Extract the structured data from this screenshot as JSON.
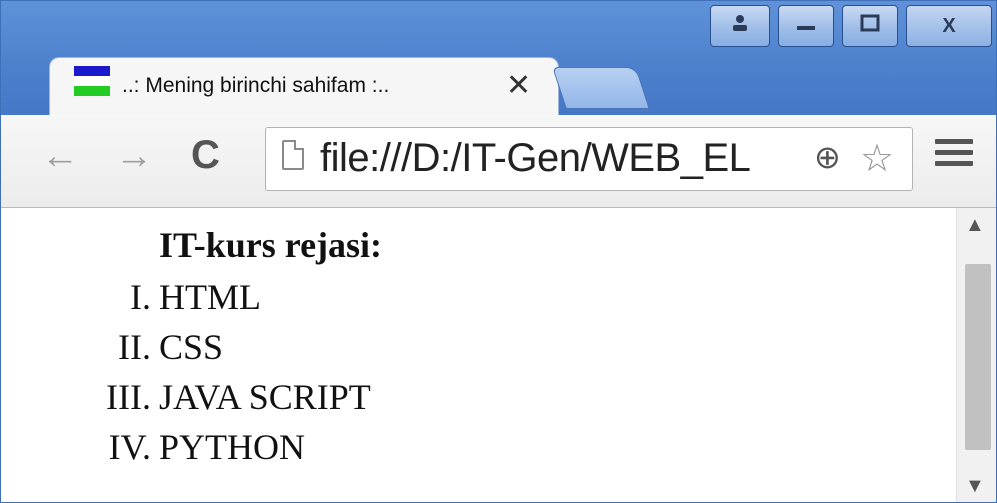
{
  "window": {
    "caption_buttons": {
      "user_icon": "person-icon",
      "minimize_icon": "minimize-icon",
      "maximize_icon": "maximize-icon",
      "close_label": "X"
    }
  },
  "tab": {
    "title": "..: Mening birinchi sahifam :..",
    "close_label": "✕",
    "favicon_colors": [
      "#1a1acc",
      "#ffffff",
      "#22cc22"
    ]
  },
  "toolbar": {
    "back_icon": "back-arrow-icon",
    "forward_icon": "forward-arrow-icon",
    "reload_icon": "reload-icon",
    "url": "file:///D:/IT-Gen/WEB_EL",
    "zoom_icon": "zoom-icon",
    "star_icon": "star-icon",
    "menu_icon": "menu-icon"
  },
  "page": {
    "heading": "IT-kurs rejasi:",
    "items": [
      {
        "marker": "I.",
        "text": "HTML"
      },
      {
        "marker": "II.",
        "text": "CSS"
      },
      {
        "marker": "III.",
        "text": "JAVA SCRIPT"
      },
      {
        "marker": "IV.",
        "text": "PYTHON"
      }
    ]
  },
  "colors": {
    "frame": "#4c7fcc",
    "tab_bg": "#f6f6f6"
  }
}
